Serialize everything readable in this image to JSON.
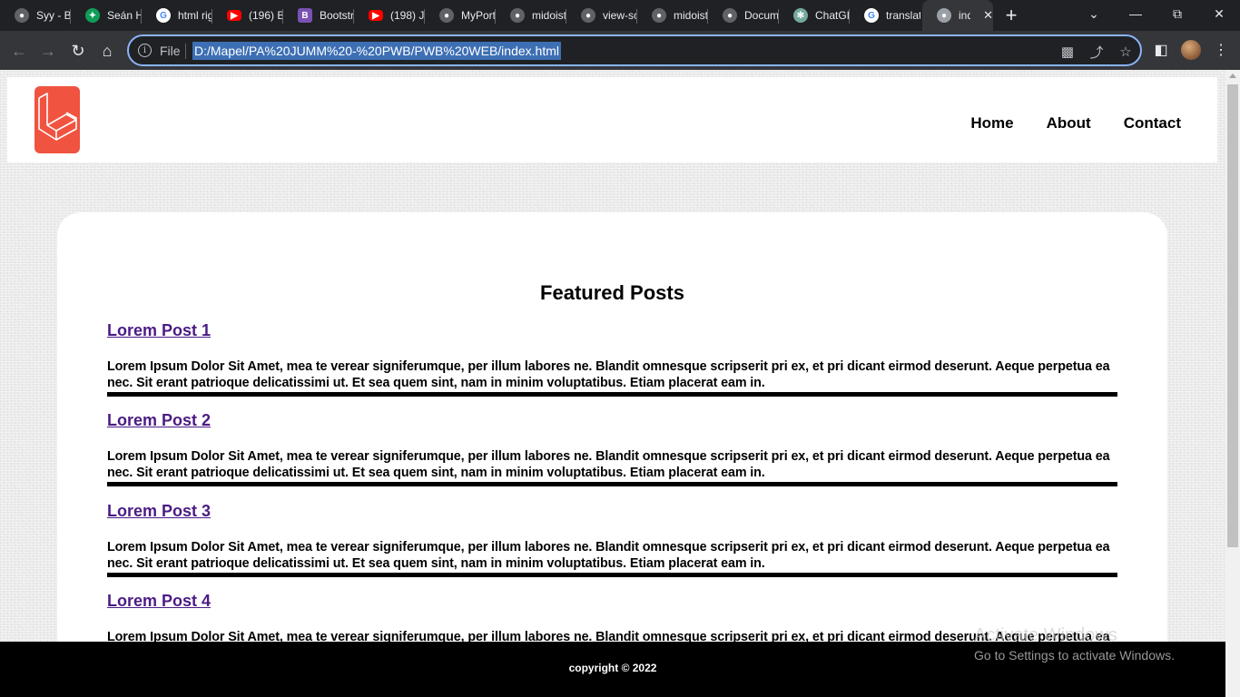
{
  "browser": {
    "tabs": [
      {
        "label": "Syy - B",
        "favicon": "globe-icon",
        "color": "#5f6368"
      },
      {
        "label": "Seán H",
        "favicon": "sparkle-icon",
        "color": "#0f9d58"
      },
      {
        "label": "html rig",
        "favicon": "google-icon",
        "color": "#ffffff"
      },
      {
        "label": "(196) B",
        "favicon": "youtube-icon",
        "color": "#ff0000"
      },
      {
        "label": "Bootstr",
        "favicon": "bootstrap-icon",
        "color": "#7952b3"
      },
      {
        "label": "(198) Ju",
        "favicon": "youtube-icon",
        "color": "#ff0000"
      },
      {
        "label": "MyPort",
        "favicon": "globe-icon",
        "color": "#5f6368"
      },
      {
        "label": "midoist",
        "favicon": "globe-icon",
        "color": "#5f6368"
      },
      {
        "label": "view-sc",
        "favicon": "globe-icon",
        "color": "#5f6368"
      },
      {
        "label": "midoist",
        "favicon": "globe-icon",
        "color": "#5f6368"
      },
      {
        "label": "Docum",
        "favicon": "globe-icon",
        "color": "#5f6368"
      },
      {
        "label": "ChatGI",
        "favicon": "chatgpt-icon",
        "color": "#74aa9c"
      },
      {
        "label": "translat",
        "favicon": "google-icon",
        "color": "#ffffff"
      }
    ],
    "active_tab": {
      "label": "ind",
      "favicon": "globe-icon"
    },
    "omnibox": {
      "scheme_label": "File",
      "url": "D:/Mapel/PA%20JUMM%20-%20PWB/PWB%20WEB/index.html"
    }
  },
  "site": {
    "nav": [
      "Home",
      "About",
      "Contact"
    ],
    "logo": "laravel-logo",
    "featured_title": "Featured Posts",
    "posts": [
      {
        "title": "Lorem Post 1",
        "body": "Lorem Ipsum Dolor Sit Amet, mea te verear signiferumque, per illum labores ne. Blandit omnesque scripserit pri ex, et pri dicant eirmod deserunt. Aeque perpetua ea nec. Sit erant patrioque delicatissimi ut. Et sea quem sint, nam in minim voluptatibus. Etiam placerat eam in."
      },
      {
        "title": "Lorem Post 2",
        "body": "Lorem Ipsum Dolor Sit Amet, mea te verear signiferumque, per illum labores ne. Blandit omnesque scripserit pri ex, et pri dicant eirmod deserunt. Aeque perpetua ea nec. Sit erant patrioque delicatissimi ut. Et sea quem sint, nam in minim voluptatibus. Etiam placerat eam in."
      },
      {
        "title": "Lorem Post 3",
        "body": "Lorem Ipsum Dolor Sit Amet, mea te verear signiferumque, per illum labores ne. Blandit omnesque scripserit pri ex, et pri dicant eirmod deserunt. Aeque perpetua ea nec. Sit erant patrioque delicatissimi ut. Et sea quem sint, nam in minim voluptatibus. Etiam placerat eam in."
      },
      {
        "title": "Lorem Post 4",
        "body": "Lorem Ipsum Dolor Sit Amet, mea te verear signiferumque, per illum labores ne. Blandit omnesque scripserit pri ex, et pri dicant eirmod deserunt. Aeque perpetua ea nec. Sit erant patrioque delicatissimi ut. Et sea quem sint, nam in minim voluptatibus. Etiam placerat eam in."
      }
    ],
    "footer": "copyright © 2022"
  },
  "os_overlay": {
    "title": "Activate Windows",
    "subtitle": "Go to Settings to activate Windows."
  },
  "colors": {
    "link": "#4b1c84",
    "logo": "#f05340",
    "chrome_dark": "#202124",
    "chrome_toolbar": "#35363a",
    "url_highlight": "#3d6fb4",
    "focus_ring": "#8ab4f8"
  }
}
